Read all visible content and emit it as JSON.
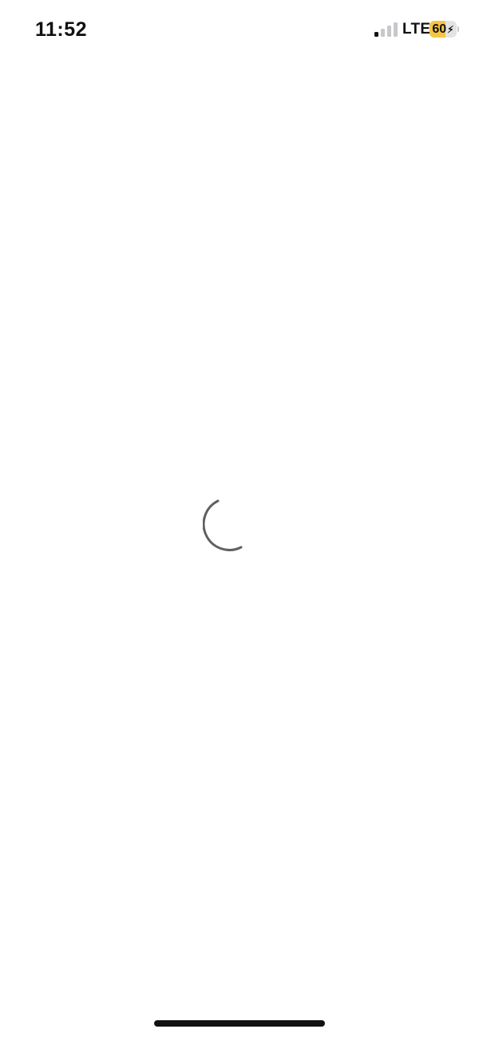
{
  "status_bar": {
    "time": "11:52",
    "network": "LTE",
    "battery": {
      "percent": 60,
      "label": "60",
      "charging": true,
      "fill_color": "#f5c644"
    },
    "signal": {
      "bars_total": 4,
      "bars_active": 1
    }
  },
  "content": {
    "state": "loading",
    "spinner_icon": "loading-spinner-icon"
  }
}
